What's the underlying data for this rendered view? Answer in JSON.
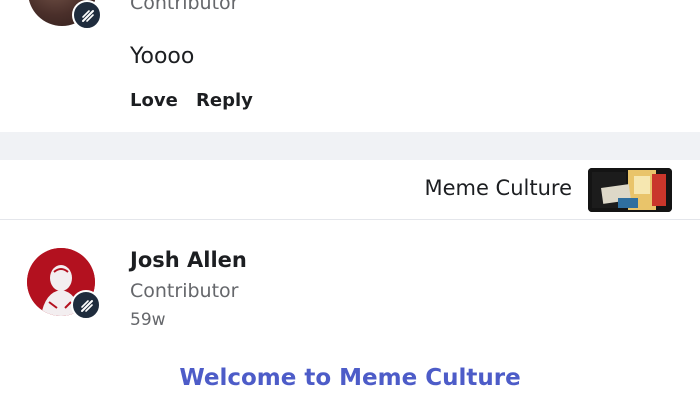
{
  "comment1": {
    "role": "Contributor",
    "text": "Yoooo",
    "actions": {
      "love": "Love",
      "reply": "Reply"
    }
  },
  "group": {
    "name": "Meme Culture"
  },
  "comment2": {
    "author": "Josh Allen",
    "role": "Contributor",
    "time": "59w",
    "body_heading": "Welcome to Meme Culture"
  },
  "colors": {
    "accent": "#4d5cc8",
    "muted_text": "#65676b",
    "divider_band": "#f0f2f5",
    "badge_bg": "#1f2c3d"
  },
  "icons": {
    "badge": "contributor-badge-icon"
  }
}
